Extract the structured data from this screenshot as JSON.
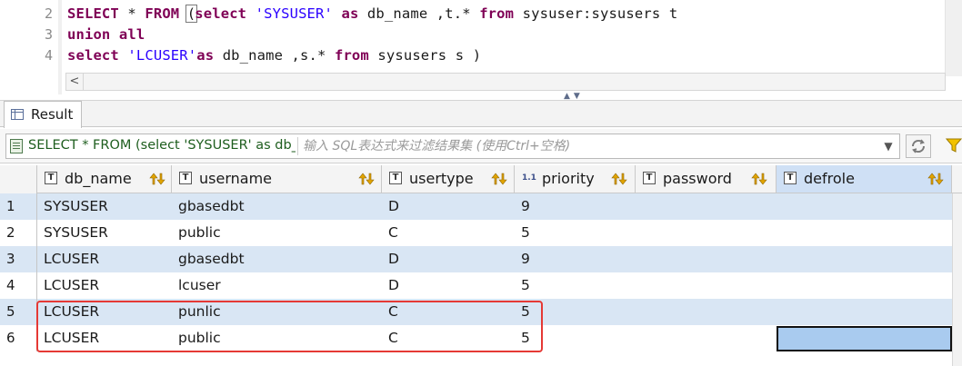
{
  "editor": {
    "lines": [
      {
        "num": "2",
        "segments": [
          {
            "t": "SELECT",
            "c": "kw"
          },
          {
            "t": " * ",
            "c": ""
          },
          {
            "t": "FROM",
            "c": "kw"
          },
          {
            "t": " ",
            "c": ""
          },
          {
            "t": "(",
            "c": "paren"
          },
          {
            "t": "select",
            "c": "kw"
          },
          {
            "t": " ",
            "c": ""
          },
          {
            "t": "'SYSUSER'",
            "c": "str"
          },
          {
            "t": " ",
            "c": ""
          },
          {
            "t": "as",
            "c": "kw"
          },
          {
            "t": " db_name ,t.* ",
            "c": ""
          },
          {
            "t": "from",
            "c": "kw"
          },
          {
            "t": " sysuser:sysusers t",
            "c": ""
          }
        ]
      },
      {
        "num": "3",
        "segments": [
          {
            "t": "union all",
            "c": "kw"
          }
        ]
      },
      {
        "num": "4",
        "segments": [
          {
            "t": "select",
            "c": "kw"
          },
          {
            "t": " ",
            "c": ""
          },
          {
            "t": "'LCUSER'",
            "c": "str"
          },
          {
            "t": "as",
            "c": "kw"
          },
          {
            "t": " db_name ,s.* ",
            "c": ""
          },
          {
            "t": "from",
            "c": "kw"
          },
          {
            "t": " sysusers s )",
            "c": ""
          }
        ]
      }
    ],
    "scroll_left_glyph": "<"
  },
  "result_tab": {
    "label": "Result"
  },
  "filter": {
    "sql_text": "SELECT * FROM (select 'SYSUSER' as db_name ,t.* from sysuser:sysusers t",
    "placeholder": "输入 SQL表达式来过滤结果集 (使用Ctrl+空格)"
  },
  "grid": {
    "columns": [
      {
        "label": "db_name",
        "type": "text"
      },
      {
        "label": "username",
        "type": "text"
      },
      {
        "label": "usertype",
        "type": "text"
      },
      {
        "label": "priority",
        "type": "number"
      },
      {
        "label": "password",
        "type": "text"
      },
      {
        "label": "defrole",
        "type": "text"
      }
    ],
    "rows": [
      {
        "num": "1",
        "cells": [
          "SYSUSER",
          "gbasedbt",
          "D",
          "9",
          "",
          ""
        ]
      },
      {
        "num": "2",
        "cells": [
          "SYSUSER",
          "public",
          "C",
          "5",
          "",
          ""
        ]
      },
      {
        "num": "3",
        "cells": [
          "LCUSER",
          "gbasedbt",
          "D",
          "9",
          "",
          ""
        ]
      },
      {
        "num": "4",
        "cells": [
          "LCUSER",
          "lcuser",
          "D",
          "5",
          "",
          ""
        ]
      },
      {
        "num": "5",
        "cells": [
          "LCUSER",
          "punlic",
          "C",
          "5",
          "",
          ""
        ]
      },
      {
        "num": "6",
        "cells": [
          "LCUSER",
          "public",
          "C",
          "5",
          "",
          ""
        ]
      }
    ],
    "active_column": "defrole",
    "selected_row": "6",
    "highlighted_rows": [
      "5",
      "6"
    ]
  },
  "colors": {
    "keyword": "#7f0055",
    "string": "#2a00ff",
    "row_alt": "#d9e6f4",
    "selection": "#a9cbef",
    "highlight_border": "#e53935"
  }
}
